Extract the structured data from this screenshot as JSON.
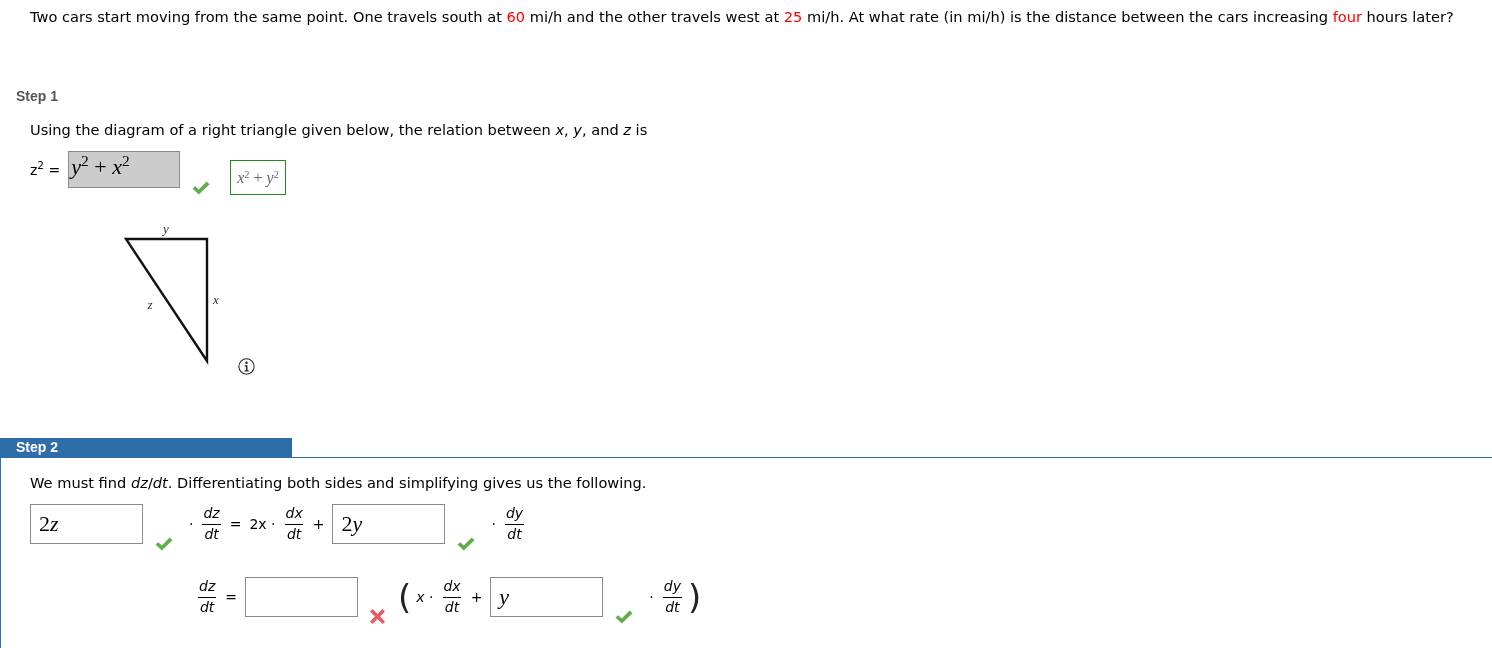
{
  "problem": {
    "segments": [
      {
        "text": "Two cars start moving from the same point. One travels south at ",
        "highlight": false
      },
      {
        "text": "60",
        "highlight": true
      },
      {
        "text": " mi/h and the other travels west at ",
        "highlight": false
      },
      {
        "text": "25",
        "highlight": true
      },
      {
        "text": " mi/h. At what rate (in mi/h) is the distance between the cars increasing ",
        "highlight": false
      },
      {
        "text": "four",
        "highlight": true
      },
      {
        "text": " hours later?",
        "highlight": false
      }
    ]
  },
  "steps": [
    {
      "title": "Step 1",
      "selected": false,
      "intro": "Using the diagram of a right triangle given below, the relation between *x*, *y*, and *z* is",
      "equations": [
        {
          "tokens": [
            {
              "kind": "text",
              "text": "z$^{2}$ ="
            },
            {
              "kind": "field",
              "value": "y$^{2}$ + x$^{2}$",
              "locked": true,
              "correct": true
            },
            {
              "kind": "key",
              "value": "x$^{2}$ + y$^{2}$"
            }
          ]
        }
      ],
      "diagram": {
        "top_label": "y",
        "hypotenuse_label": "z",
        "side_label": "x"
      }
    },
    {
      "title": "Step 2",
      "selected": true,
      "intro": "We must find *dz*/*dt*. Differentiating both sides and simplifying gives us the following.",
      "equations": [
        {
          "tokens": [
            {
              "kind": "field",
              "value": "2z",
              "locked": false,
              "correct": true
            },
            {
              "kind": "text",
              "text": "·"
            },
            {
              "kind": "fraction",
              "numerator": "dz",
              "denominator": "dt"
            },
            {
              "kind": "text",
              "text": "="
            },
            {
              "kind": "text",
              "text": "2x ·"
            },
            {
              "kind": "fraction",
              "numerator": "dx",
              "denominator": "dt"
            },
            {
              "kind": "text",
              "text": "+"
            },
            {
              "kind": "field",
              "value": "2y",
              "locked": false,
              "correct": true
            },
            {
              "kind": "text",
              "text": "·"
            },
            {
              "kind": "fraction",
              "numerator": "dy",
              "denominator": "dt"
            }
          ]
        },
        {
          "tokens": [
            {
              "kind": "fraction",
              "numerator": "dz",
              "denominator": "dt"
            },
            {
              "kind": "text",
              "text": "="
            },
            {
              "kind": "field",
              "locked": false,
              "correct": false
            },
            {
              "kind": "paren",
              "text": "("
            },
            {
              "kind": "text",
              "text": "*x* ·"
            },
            {
              "kind": "fraction",
              "numerator": "dx",
              "denominator": "dt"
            },
            {
              "kind": "text",
              "text": "+"
            },
            {
              "kind": "field",
              "value": "y",
              "locked": false,
              "correct": true
            },
            {
              "kind": "text",
              "text": "·"
            },
            {
              "kind": "fraction",
              "numerator": "dy",
              "denominator": "dt"
            },
            {
              "kind": "paren",
              "text": ")"
            }
          ]
        }
      ]
    }
  ]
}
